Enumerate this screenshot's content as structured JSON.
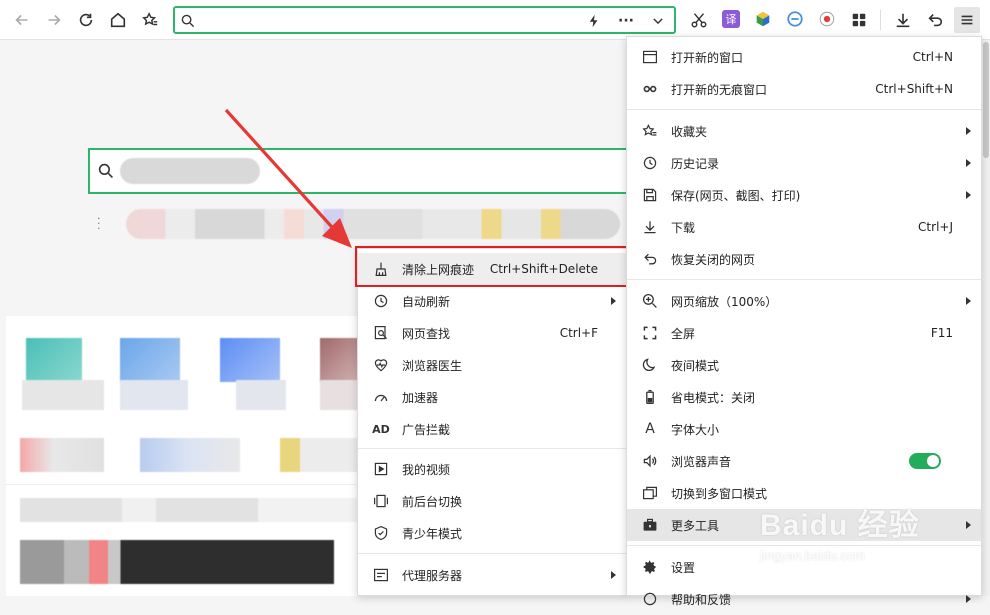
{
  "toolbar": {
    "address_value": "",
    "translate_badge": "译"
  },
  "main_menu": {
    "items": [
      {
        "label": "打开新的窗口",
        "shortcut": "Ctrl+N",
        "icon": "window-icon"
      },
      {
        "label": "打开新的无痕窗口",
        "shortcut": "Ctrl+Shift+N",
        "icon": "incognito-icon"
      },
      {
        "label": "收藏夹",
        "shortcut": "",
        "icon": "star-list-icon"
      },
      {
        "label": "历史记录",
        "shortcut": "",
        "icon": "clock-icon"
      },
      {
        "label": "保存(网页、截图、打印)",
        "shortcut": "",
        "icon": "save-icon"
      },
      {
        "label": "下载",
        "shortcut": "Ctrl+J",
        "icon": "download-icon"
      },
      {
        "label": "恢复关闭的网页",
        "shortcut": "",
        "icon": "undo-icon"
      },
      {
        "label": "网页缩放（100%）",
        "shortcut": "",
        "icon": "zoom-icon"
      },
      {
        "label": "全屏",
        "shortcut": "F11",
        "icon": "fullscreen-icon"
      },
      {
        "label": "夜间模式",
        "shortcut": "",
        "icon": "moon-icon"
      },
      {
        "label": "省电模式：关闭",
        "shortcut": "",
        "icon": "battery-icon"
      },
      {
        "label": "字体大小",
        "shortcut": "",
        "icon": "font-size-icon"
      },
      {
        "label": "浏览器声音",
        "shortcut": "",
        "icon": "speaker-icon"
      },
      {
        "label": "切换到多窗口模式",
        "shortcut": "",
        "icon": "multi-window-icon"
      },
      {
        "label": "更多工具",
        "shortcut": "",
        "icon": "toolbox-icon"
      },
      {
        "label": "设置",
        "shortcut": "",
        "icon": "gear-icon"
      },
      {
        "label": "帮助和反馈",
        "shortcut": "",
        "icon": "help-icon"
      }
    ]
  },
  "tools_submenu": {
    "items": [
      {
        "label": "清除上网痕迹",
        "shortcut": "Ctrl+Shift+Delete",
        "icon": "broom-icon"
      },
      {
        "label": "自动刷新",
        "shortcut": "",
        "icon": "refresh-clock-icon"
      },
      {
        "label": "网页查找",
        "shortcut": "Ctrl+F",
        "icon": "find-icon"
      },
      {
        "label": "浏览器医生",
        "shortcut": "",
        "icon": "heart-icon"
      },
      {
        "label": "加速器",
        "shortcut": "",
        "icon": "speedometer-icon"
      },
      {
        "label": "广告拦截",
        "shortcut": "",
        "icon": "ad-block-icon"
      },
      {
        "label": "我的视频",
        "shortcut": "",
        "icon": "video-icon"
      },
      {
        "label": "前后台切换",
        "shortcut": "",
        "icon": "switch-icon"
      },
      {
        "label": "青少年模式",
        "shortcut": "",
        "icon": "shield-icon"
      },
      {
        "label": "代理服务器",
        "shortcut": "",
        "icon": "proxy-icon"
      }
    ]
  },
  "sound_toggle": {
    "on": true
  },
  "colors": {
    "accent": "#2db66a",
    "highlight": "#e02020",
    "toggle": "#23ad5b"
  },
  "watermark": {
    "brand": "Baidu 经验",
    "url": "jingyan.baidu.com"
  }
}
